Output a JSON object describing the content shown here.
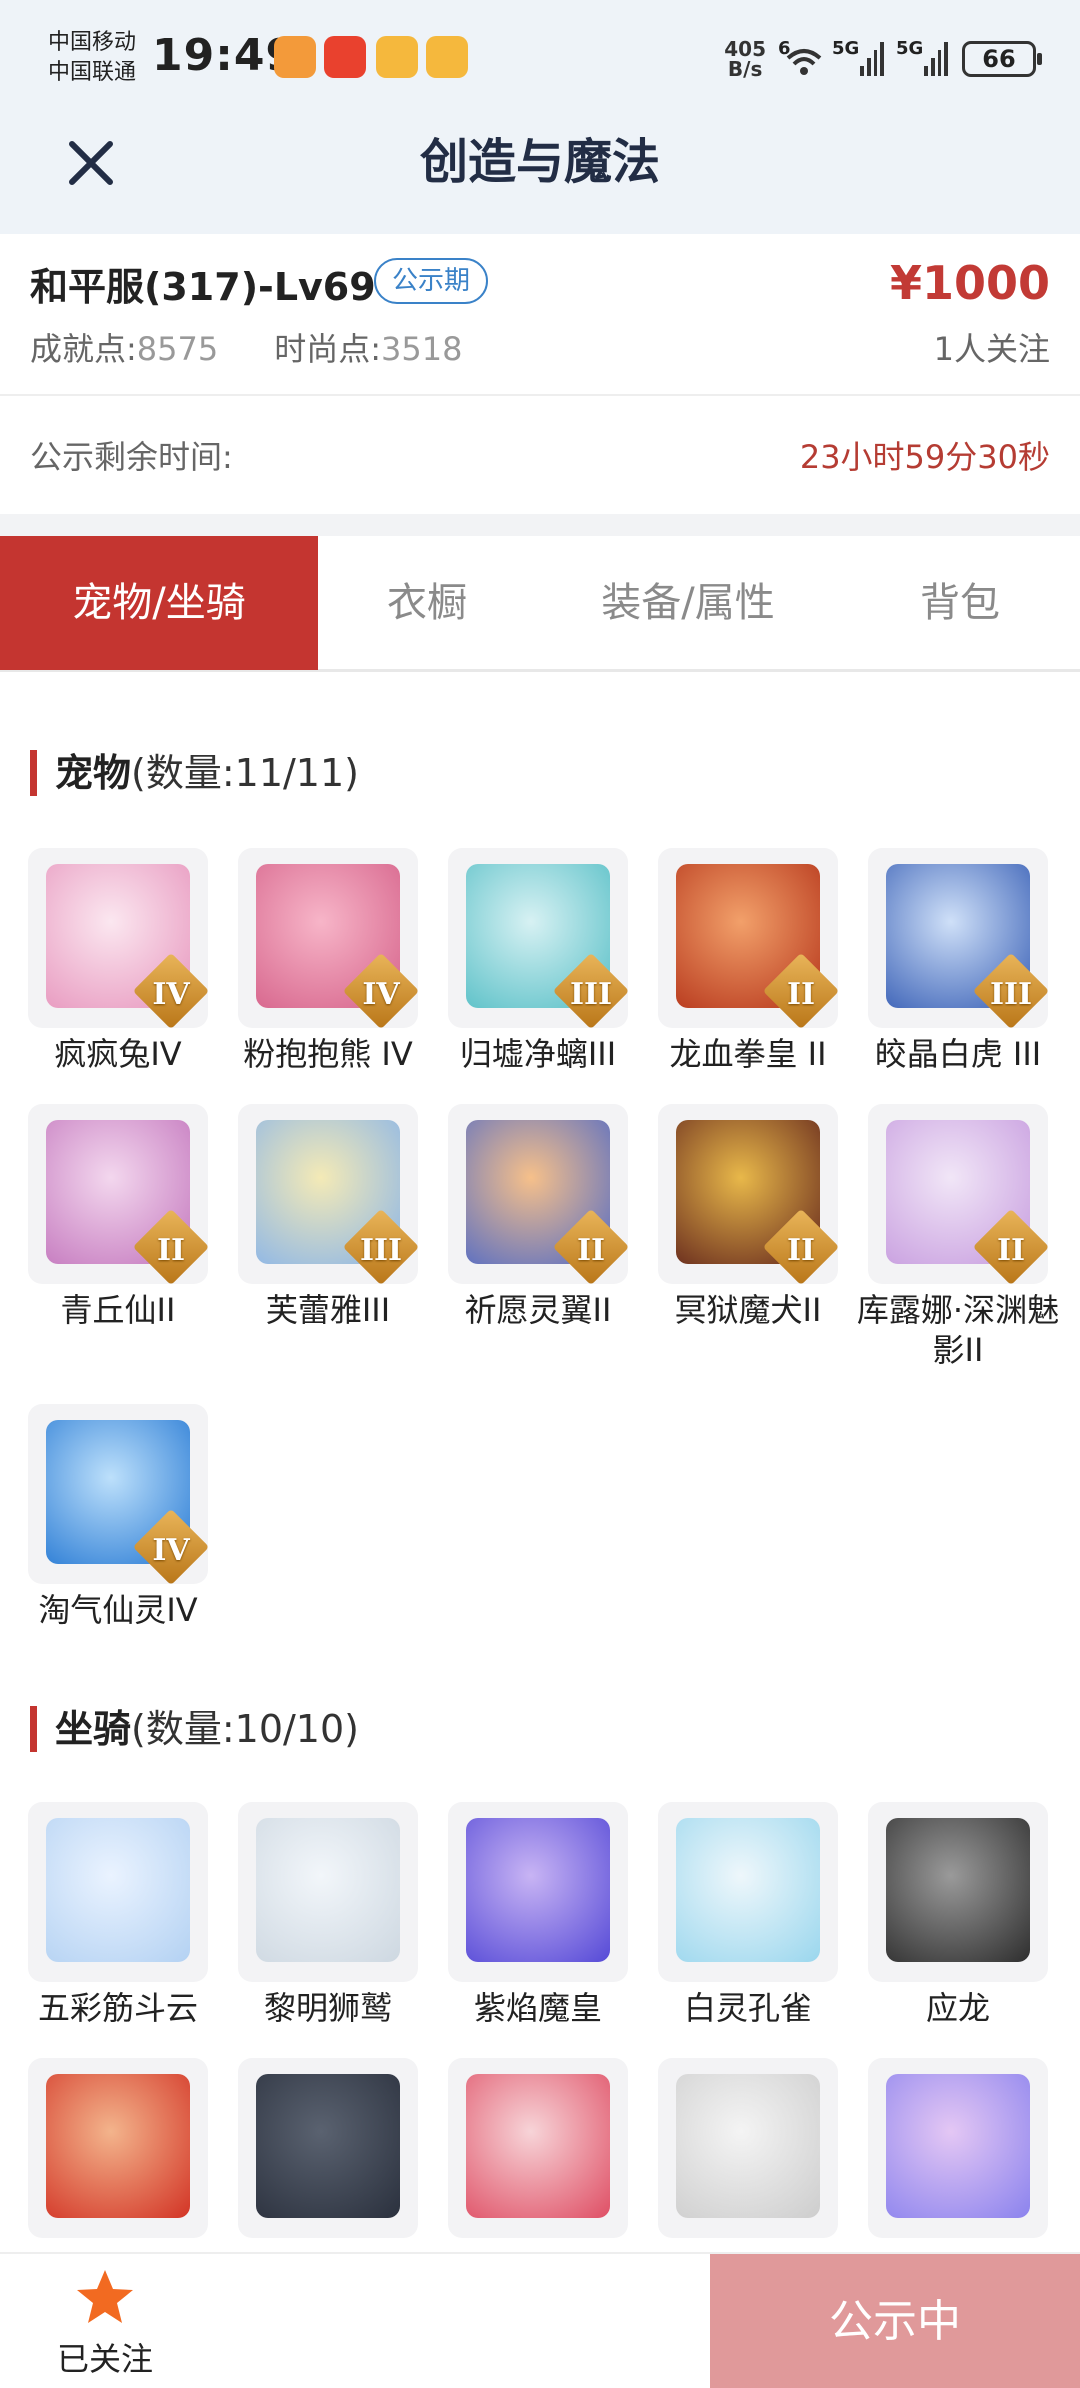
{
  "status_bar": {
    "carrier1": "中国移动",
    "carrier2": "中国联通",
    "time": "19:49",
    "net_speed_value": "405",
    "net_speed_unit": "B/s",
    "wifi_label": "6",
    "sig1_label": "5G",
    "sig2_label": "5G",
    "battery": "66"
  },
  "header": {
    "title": "创造与魔法",
    "close_icon": "close-icon"
  },
  "summary": {
    "server": "和平服(317)-Lv69",
    "badge": "公示期",
    "price": "¥1000",
    "achievement_label": "成就点:",
    "achievement_value": "8575",
    "fashion_label": "时尚点:",
    "fashion_value": "3518",
    "followers": "1人关注"
  },
  "timer": {
    "label": "公示剩余时间:",
    "value": "23小时59分30秒"
  },
  "tabs": [
    "宠物/坐骑",
    "衣橱",
    "装备/属性",
    "背包"
  ],
  "pets": {
    "title": "宠物",
    "count": "(数量:11/11)",
    "items": [
      {
        "name": "疯疯兔IV",
        "tier": "IV"
      },
      {
        "name": "粉抱抱熊 IV",
        "tier": "IV"
      },
      {
        "name": "归墟净螭III",
        "tier": "III"
      },
      {
        "name": "龙血拳皇 II",
        "tier": "II"
      },
      {
        "name": "皎晶白虎 III",
        "tier": "III"
      },
      {
        "name": "青丘仙II",
        "tier": "II"
      },
      {
        "name": "芙蕾雅III",
        "tier": "III"
      },
      {
        "name": "祈愿灵翼II",
        "tier": "II"
      },
      {
        "name": "冥狱魔犬II",
        "tier": "II"
      },
      {
        "name": "库露娜·深渊魅影II",
        "tier": "II"
      },
      {
        "name": "淘气仙灵IV",
        "tier": "IV"
      }
    ]
  },
  "mounts": {
    "title": "坐骑",
    "count": "(数量:10/10)",
    "items": [
      {
        "name": "五彩筋斗云"
      },
      {
        "name": "黎明狮鹫"
      },
      {
        "name": "紫焰魔皇"
      },
      {
        "name": "白灵孔雀"
      },
      {
        "name": "应龙"
      },
      {
        "name": ""
      },
      {
        "name": ""
      },
      {
        "name": ""
      },
      {
        "name": ""
      },
      {
        "name": ""
      }
    ]
  },
  "bottom": {
    "follow_label": "已关注",
    "status_button": "公示中"
  },
  "colors": {
    "accent": "#c43530",
    "price": "#c23a35",
    "badge": "#3a82c8",
    "status_button": "#e0999a",
    "star": "#f26a21"
  }
}
